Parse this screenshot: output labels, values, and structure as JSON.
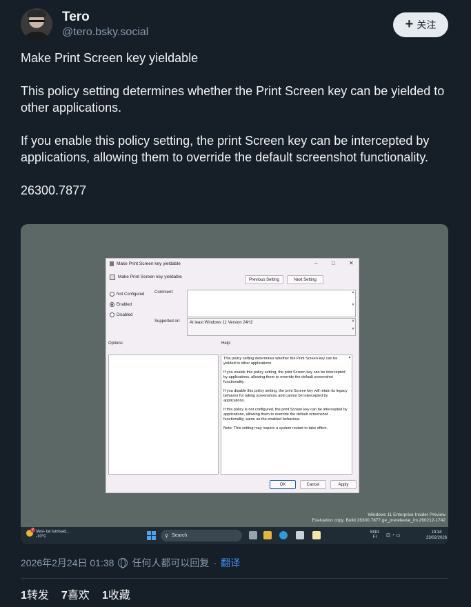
{
  "author": {
    "name": "Tero",
    "handle": "@tero.bsky.social",
    "follow_label": "关注"
  },
  "post": {
    "paragraphs": [
      "Make Print Screen key yieldable",
      "This policy setting determines whether the Print Screen key can be yielded to other applications.",
      "If you enable this policy setting, the print Screen key can be intercepted by applications, allowing them to override the default screenshot functionality.",
      "26300.7877"
    ],
    "timestamp": "2026年2月24日 01:38",
    "reply_setting": "任何人都可以回复",
    "separator": "·",
    "translate_label": "翻译"
  },
  "stats": {
    "reposts_count": "1",
    "reposts_label": "转发",
    "likes_count": "7",
    "likes_label": "喜欢",
    "bookmarks_count": "1",
    "bookmarks_label": "收藏"
  },
  "screenshot": {
    "dialog": {
      "title": "Make Print Screen key yieldable",
      "header": "Make Print Screen key yieldable",
      "prev_button": "Previous Setting",
      "next_button": "Next Setting",
      "radio_not_configured": "Not Configured",
      "radio_enabled": "Enabled",
      "radio_disabled": "Disabled",
      "selected_option": "Enabled",
      "comment_label": "Comment:",
      "supported_label": "Supported on:",
      "supported_value": "At least Windows 11 Version 24H2",
      "options_label": "Options:",
      "help_label": "Help:",
      "help_paragraphs": [
        "This policy setting determines whether the Print Screen key can be yielded to other applications.",
        "If you enable this policy setting, the print Screen key can be intercepted by applications, allowing them to override the default screenshot functionality.",
        "If you disable this policy setting, the print Screen key will retain its legacy behavior for taking screenshots and cannot be intercepted by applications.",
        "If this policy is not configured, the print Screen key can be intercepted by applications, allowing them to override the default screenshot functionality, same as the enabled behaviour.",
        "Note: This setting may require a system restart to take effect."
      ],
      "ok_button": "OK",
      "cancel_button": "Cancel",
      "apply_button": "Apply"
    },
    "watermark_line1": "Windows 11 Enterprise Insider Preview",
    "watermark_line2": "Evaluation copy. Build 26300.7877.ge_prerelease_im.260212-1742",
    "taskbar": {
      "weather_line1": "Vesi- tai lumisad...",
      "weather_line2": "-10°C",
      "weather_badge": "2",
      "search_placeholder": "Search",
      "lang_line1": "ENG",
      "lang_line2": "FI",
      "time": "19.34",
      "date": "23/02/2026"
    },
    "colors": {
      "desktop": "#5b6866",
      "taskbar": "#1f2b35"
    }
  },
  "colors": {
    "background": "#161e27",
    "text": "#f1f3f5",
    "muted": "#8a9bb0",
    "link": "#3b8ff2"
  }
}
